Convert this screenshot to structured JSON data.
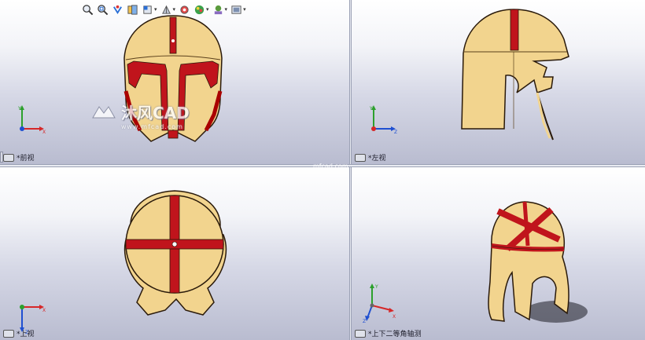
{
  "viewports": {
    "front": {
      "label": "*前视"
    },
    "left": {
      "label": "*左视"
    },
    "top": {
      "label": "*上视"
    },
    "iso": {
      "label": "*上下二等角轴测"
    }
  },
  "watermark": {
    "name": "沐风CAD",
    "url": "www.mfcad.com"
  },
  "edge_text": "mfcad.com",
  "toolbar": {
    "icons": [
      "zoom-to-fit-icon",
      "zoom-area-icon",
      "previous-view-icon",
      "section-view-icon",
      "view-orientation-icon",
      "display-style-icon",
      "hide-show-items-icon",
      "edit-appearance-icon",
      "apply-scene-icon",
      "view-settings-icon"
    ]
  },
  "colors": {
    "helmet_gold": "#f2d48e",
    "helmet_red": "#c0141c",
    "outline": "#2a1a0a"
  }
}
